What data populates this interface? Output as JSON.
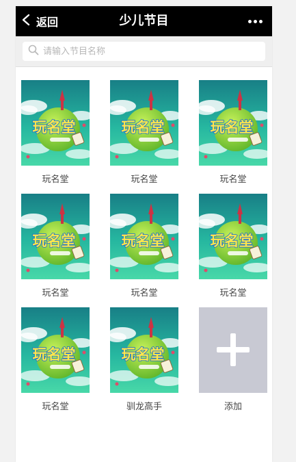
{
  "nav": {
    "back_label": "返回",
    "title": "少儿节目",
    "more_icon": "ellipsis-icon"
  },
  "search": {
    "placeholder": "请输入节目名称",
    "icon": "search-icon"
  },
  "programs": [
    {
      "label": "玩名堂",
      "logo_text": "玩名堂"
    },
    {
      "label": "玩名堂",
      "logo_text": "玩名堂"
    },
    {
      "label": "玩名堂",
      "logo_text": "玩名堂"
    },
    {
      "label": "玩名堂",
      "logo_text": "玩名堂"
    },
    {
      "label": "玩名堂",
      "logo_text": "玩名堂"
    },
    {
      "label": "玩名堂",
      "logo_text": "玩名堂"
    },
    {
      "label": "玩名堂",
      "logo_text": "玩名堂"
    },
    {
      "label": "驯龙高手",
      "logo_text": "玩名堂"
    }
  ],
  "add_tile": {
    "label": "添加",
    "icon": "plus-icon"
  },
  "colors": {
    "navbar": "#000000",
    "thumb_top": "#1a8f8a",
    "thumb_bottom": "#2fc9a0",
    "planet": "#8fd63a",
    "add_tile": "#c8c9d3"
  }
}
